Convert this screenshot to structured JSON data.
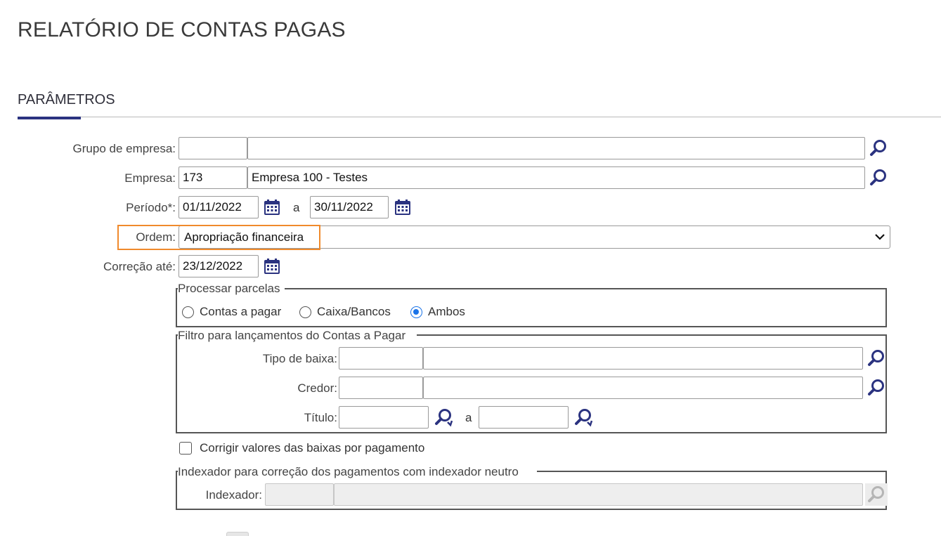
{
  "page": {
    "title": "RELATÓRIO DE CONTAS PAGAS"
  },
  "section": {
    "title": "PARÂMETROS"
  },
  "fields": {
    "grupo_empresa": {
      "label": "Grupo de empresa:",
      "code": "",
      "description": ""
    },
    "empresa": {
      "label": "Empresa:",
      "code": "173",
      "description": "Empresa 100 - Testes"
    },
    "periodo": {
      "label": "Período*:",
      "start": "01/11/2022",
      "separator": "a",
      "end": "30/11/2022"
    },
    "ordem": {
      "label": "Ordem:",
      "selected": "Apropriação financeira"
    },
    "correcao_ate": {
      "label": "Correção até:",
      "value": "23/12/2022"
    }
  },
  "processar_parcelas": {
    "legend": "Processar parcelas",
    "options": [
      {
        "label": "Contas a pagar",
        "checked": false
      },
      {
        "label": "Caixa/Bancos",
        "checked": false
      },
      {
        "label": "Ambos",
        "checked": true
      }
    ]
  },
  "filtro": {
    "legend": "Filtro para lançamentos do Contas a Pagar",
    "tipo_baixa": {
      "label": "Tipo de baixa:",
      "code": "",
      "description": ""
    },
    "credor": {
      "label": "Credor:",
      "code": "",
      "description": ""
    },
    "titulo": {
      "label": "Título:",
      "start": "",
      "separator": "a",
      "end": ""
    }
  },
  "corrigir": {
    "label": "Corrigir valores das baixas por pagamento",
    "checked": false
  },
  "indexador_group": {
    "legend": "Indexador para correção dos pagamentos com indexador neutro",
    "indexador": {
      "label": "Indexador:",
      "code": "",
      "description": "",
      "disabled": true
    }
  },
  "colors": {
    "accent": "#2b3380",
    "highlight": "#f08a2c",
    "radio_checked": "#1a73e8",
    "icon": "#2b3380"
  },
  "icons": {
    "search": "search-icon",
    "calendar": "calendar-icon",
    "chevron": "chevron-down-icon",
    "search_refresh": "search-refresh-icon"
  }
}
